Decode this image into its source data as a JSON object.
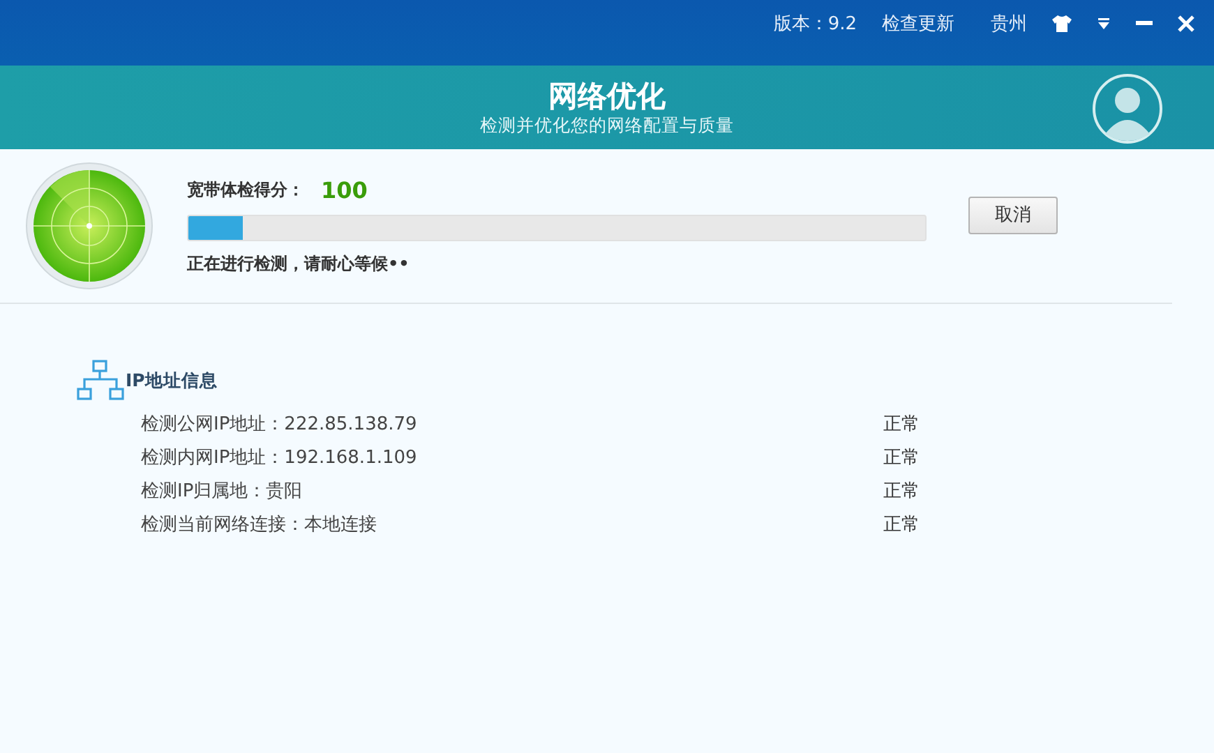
{
  "top_bar": {
    "version": "版本：9.2",
    "update_link": "检查更新",
    "city": "贵州"
  },
  "header": {
    "title": "网络优化",
    "subtitle": "检测并优化您的网络配置与质量"
  },
  "scan": {
    "score_label": "宽带体检得分：",
    "score": "100",
    "progress": {
      "level": 0.074
    },
    "status": "正在进行检测，请耐心等候••",
    "cancel_button": "取消"
  },
  "section": {
    "title": "IP地址信息",
    "rows": [
      {
        "label": "检测公网IP地址：222.85.138.79",
        "status": "正常"
      },
      {
        "label": "检测内网IP地址：192.168.1.109",
        "status": "正常"
      },
      {
        "label": "检测IP归属地：贵阳",
        "status": "正常"
      },
      {
        "label": "检测当前网络连接：本地连接",
        "status": "正常"
      }
    ]
  }
}
